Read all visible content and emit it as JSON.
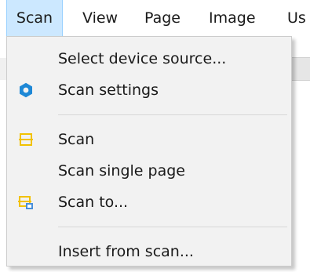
{
  "menubar": {
    "items": [
      {
        "label": "Scan"
      },
      {
        "label": "View"
      },
      {
        "label": "Page"
      },
      {
        "label": "Image"
      },
      {
        "label": "Us"
      }
    ]
  },
  "scan_menu": {
    "items": [
      {
        "label": "Select device source..."
      },
      {
        "label": "Scan settings",
        "icon": "gear-icon"
      },
      {
        "label": "Scan",
        "icon": "scan-icon"
      },
      {
        "label": "Scan single page"
      },
      {
        "label": "Scan to...",
        "icon": "scan-to-icon"
      },
      {
        "label": "Insert from scan..."
      }
    ]
  },
  "colors": {
    "menubar_active": "#cce8ff",
    "menu_background": "#f2f2f2",
    "gear_icon": "#1e88d6",
    "scan_icon": "#f2c200"
  }
}
